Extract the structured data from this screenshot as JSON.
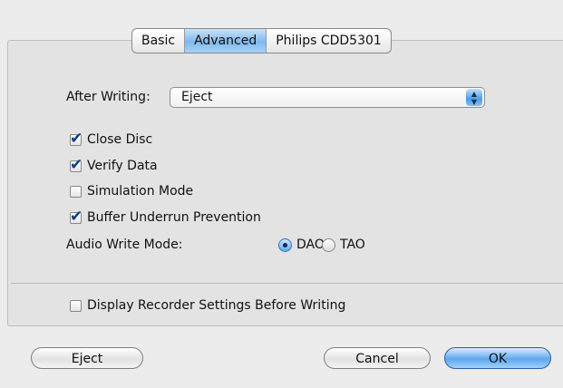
{
  "tabs": [
    {
      "label": "Basic",
      "selected": false
    },
    {
      "label": "Advanced",
      "selected": true
    },
    {
      "label": "Philips CDD5301",
      "selected": false
    }
  ],
  "after_writing": {
    "label": "After Writing:",
    "value": "Eject",
    "arrows_icon": "updown-arrows-icon"
  },
  "options": {
    "close_disc": {
      "label": "Close Disc",
      "checked": true
    },
    "verify_data": {
      "label": "Verify Data",
      "checked": true
    },
    "simulation_mode": {
      "label": "Simulation Mode",
      "checked": false
    },
    "buffer_underrun": {
      "label": "Buffer Underrun Prevention",
      "checked": true
    }
  },
  "audio_write_mode": {
    "label": "Audio Write Mode:",
    "options": [
      {
        "label": "DAO",
        "selected": true
      },
      {
        "label": "TAO",
        "selected": false
      }
    ]
  },
  "display_recorder": {
    "label": "Display Recorder Settings Before Writing",
    "checked": false
  },
  "buttons": {
    "eject": "Eject",
    "cancel": "Cancel",
    "ok": "OK"
  },
  "colors": {
    "accent": "#5fa8ee",
    "check": "#0e3c86"
  }
}
